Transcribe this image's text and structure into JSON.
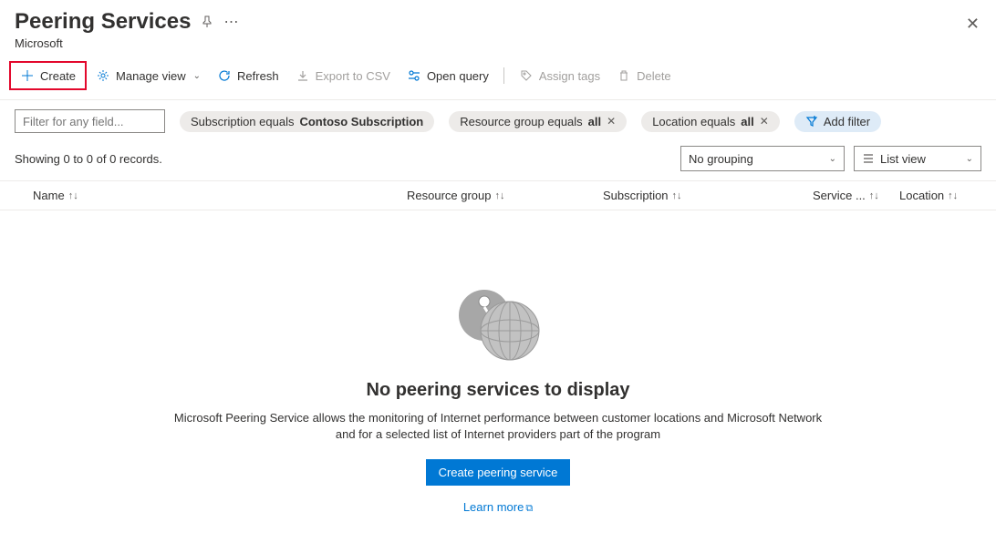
{
  "header": {
    "title": "Peering Services",
    "subtitle": "Microsoft"
  },
  "toolbar": {
    "create": "Create",
    "manage_view": "Manage view",
    "refresh": "Refresh",
    "export_csv": "Export to CSV",
    "open_query": "Open query",
    "assign_tags": "Assign tags",
    "delete": "Delete"
  },
  "filters": {
    "input_placeholder": "Filter for any field...",
    "subscription_prefix": "Subscription equals ",
    "subscription_value": "Contoso Subscription",
    "rg_prefix": "Resource group equals ",
    "rg_value": "all",
    "location_prefix": "Location equals ",
    "location_value": "all",
    "add_filter": "Add filter"
  },
  "records_text": "Showing 0 to 0 of 0 records.",
  "grouping_select": "No grouping",
  "view_select": "List view",
  "columns": {
    "name": "Name",
    "resource_group": "Resource group",
    "subscription": "Subscription",
    "service": "Service ...",
    "location": "Location"
  },
  "empty": {
    "title": "No peering services to display",
    "description": "Microsoft Peering Service allows the monitoring of Internet performance between customer locations and Microsoft Network and for a selected list of Internet providers part of the program",
    "button": "Create peering service",
    "learn_more": "Learn more"
  }
}
